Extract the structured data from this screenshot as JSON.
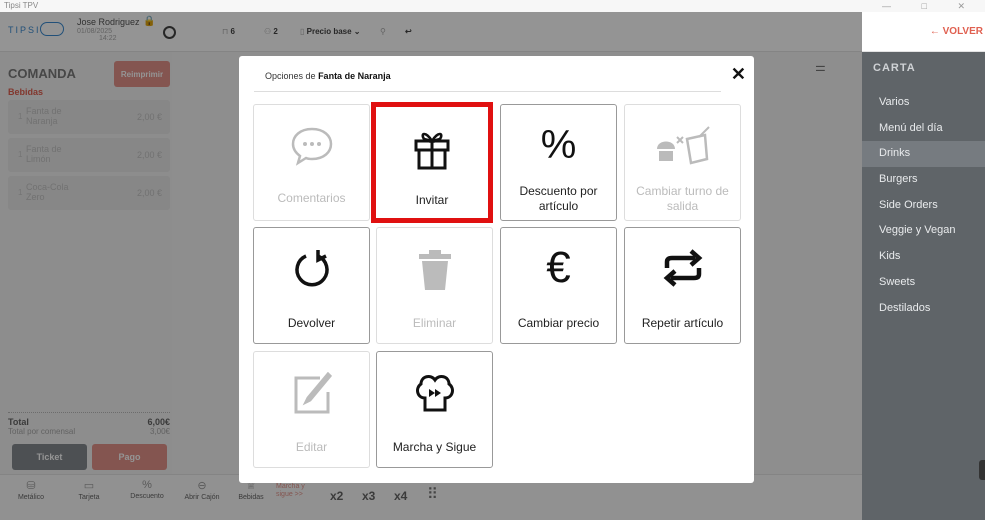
{
  "window": {
    "title": "Tipsi TPV",
    "controls": "— □ ✕"
  },
  "topbar": {
    "logo": "TIPSI",
    "user_name": "Jose Rodriguez",
    "date": "01/08/2025",
    "time": "14:22",
    "guests": "6",
    "seats": "2",
    "price_list": "Precio base",
    "back_label": "← VOLVER",
    "icons": {
      "lock": "lock-icon",
      "fingerprint": "fingerprint-icon",
      "table": "table-icon",
      "people": "people-icon"
    }
  },
  "comanda": {
    "title": "COMANDA",
    "reprint_label": "Reimprimir",
    "category": "Bebidas",
    "items": [
      {
        "qty": "1",
        "name": "Fanta de Naranja",
        "price": "2,00 €"
      },
      {
        "qty": "1",
        "name": "Fanta de Limón",
        "price": "2,00 €"
      },
      {
        "qty": "1",
        "name": "Coca-Cola Zero",
        "price": "2,00 €"
      }
    ],
    "total_label": "Total",
    "total_value": "6,00€",
    "per_guest_label": "Total por comensal",
    "per_guest_value": "3,00€",
    "ticket_label": "Ticket",
    "pay_label": "Pago"
  },
  "bottom": {
    "cash": "Metálico",
    "card": "Tarjeta",
    "discount": "Descuento",
    "open_drawer": "Abrir Cajón",
    "drinks": "Bebidas",
    "marcha": "Marcha y sigue >>",
    "x2": "x2",
    "x3": "x3",
    "x4": "x4"
  },
  "carta": {
    "title": "CARTA",
    "categories": [
      "Varios",
      "Menú del día",
      "Drinks",
      "Burgers",
      "Side Orders",
      "Veggie y Vegan",
      "Kids",
      "Sweets",
      "Destilados"
    ],
    "active": "Drinks"
  },
  "modal": {
    "title_prefix": "Opciones de",
    "title_item": "Fanta de Naranja",
    "close": "✕",
    "options": [
      {
        "label": "Comentarios",
        "icon": "speech-bubble-icon",
        "enabled": false
      },
      {
        "label": "Invitar",
        "icon": "gift-icon",
        "enabled": true,
        "selected": true
      },
      {
        "label": "Descuento por artículo",
        "icon": "percent-icon",
        "enabled": true
      },
      {
        "label": "Cambiar turno de salida",
        "icon": "food-drink-icon",
        "enabled": false
      },
      {
        "label": "Devolver",
        "icon": "return-icon",
        "enabled": true
      },
      {
        "label": "Eliminar",
        "icon": "trash-icon",
        "enabled": false
      },
      {
        "label": "Cambiar precio",
        "icon": "euro-icon",
        "enabled": true
      },
      {
        "label": "Repetir artículo",
        "icon": "repeat-icon",
        "enabled": true
      },
      {
        "label": "Editar",
        "icon": "edit-icon",
        "enabled": false
      },
      {
        "label": "Marcha y Sigue",
        "icon": "chef-hat-icon",
        "enabled": true
      }
    ],
    "highlight_color": "#e01010"
  }
}
